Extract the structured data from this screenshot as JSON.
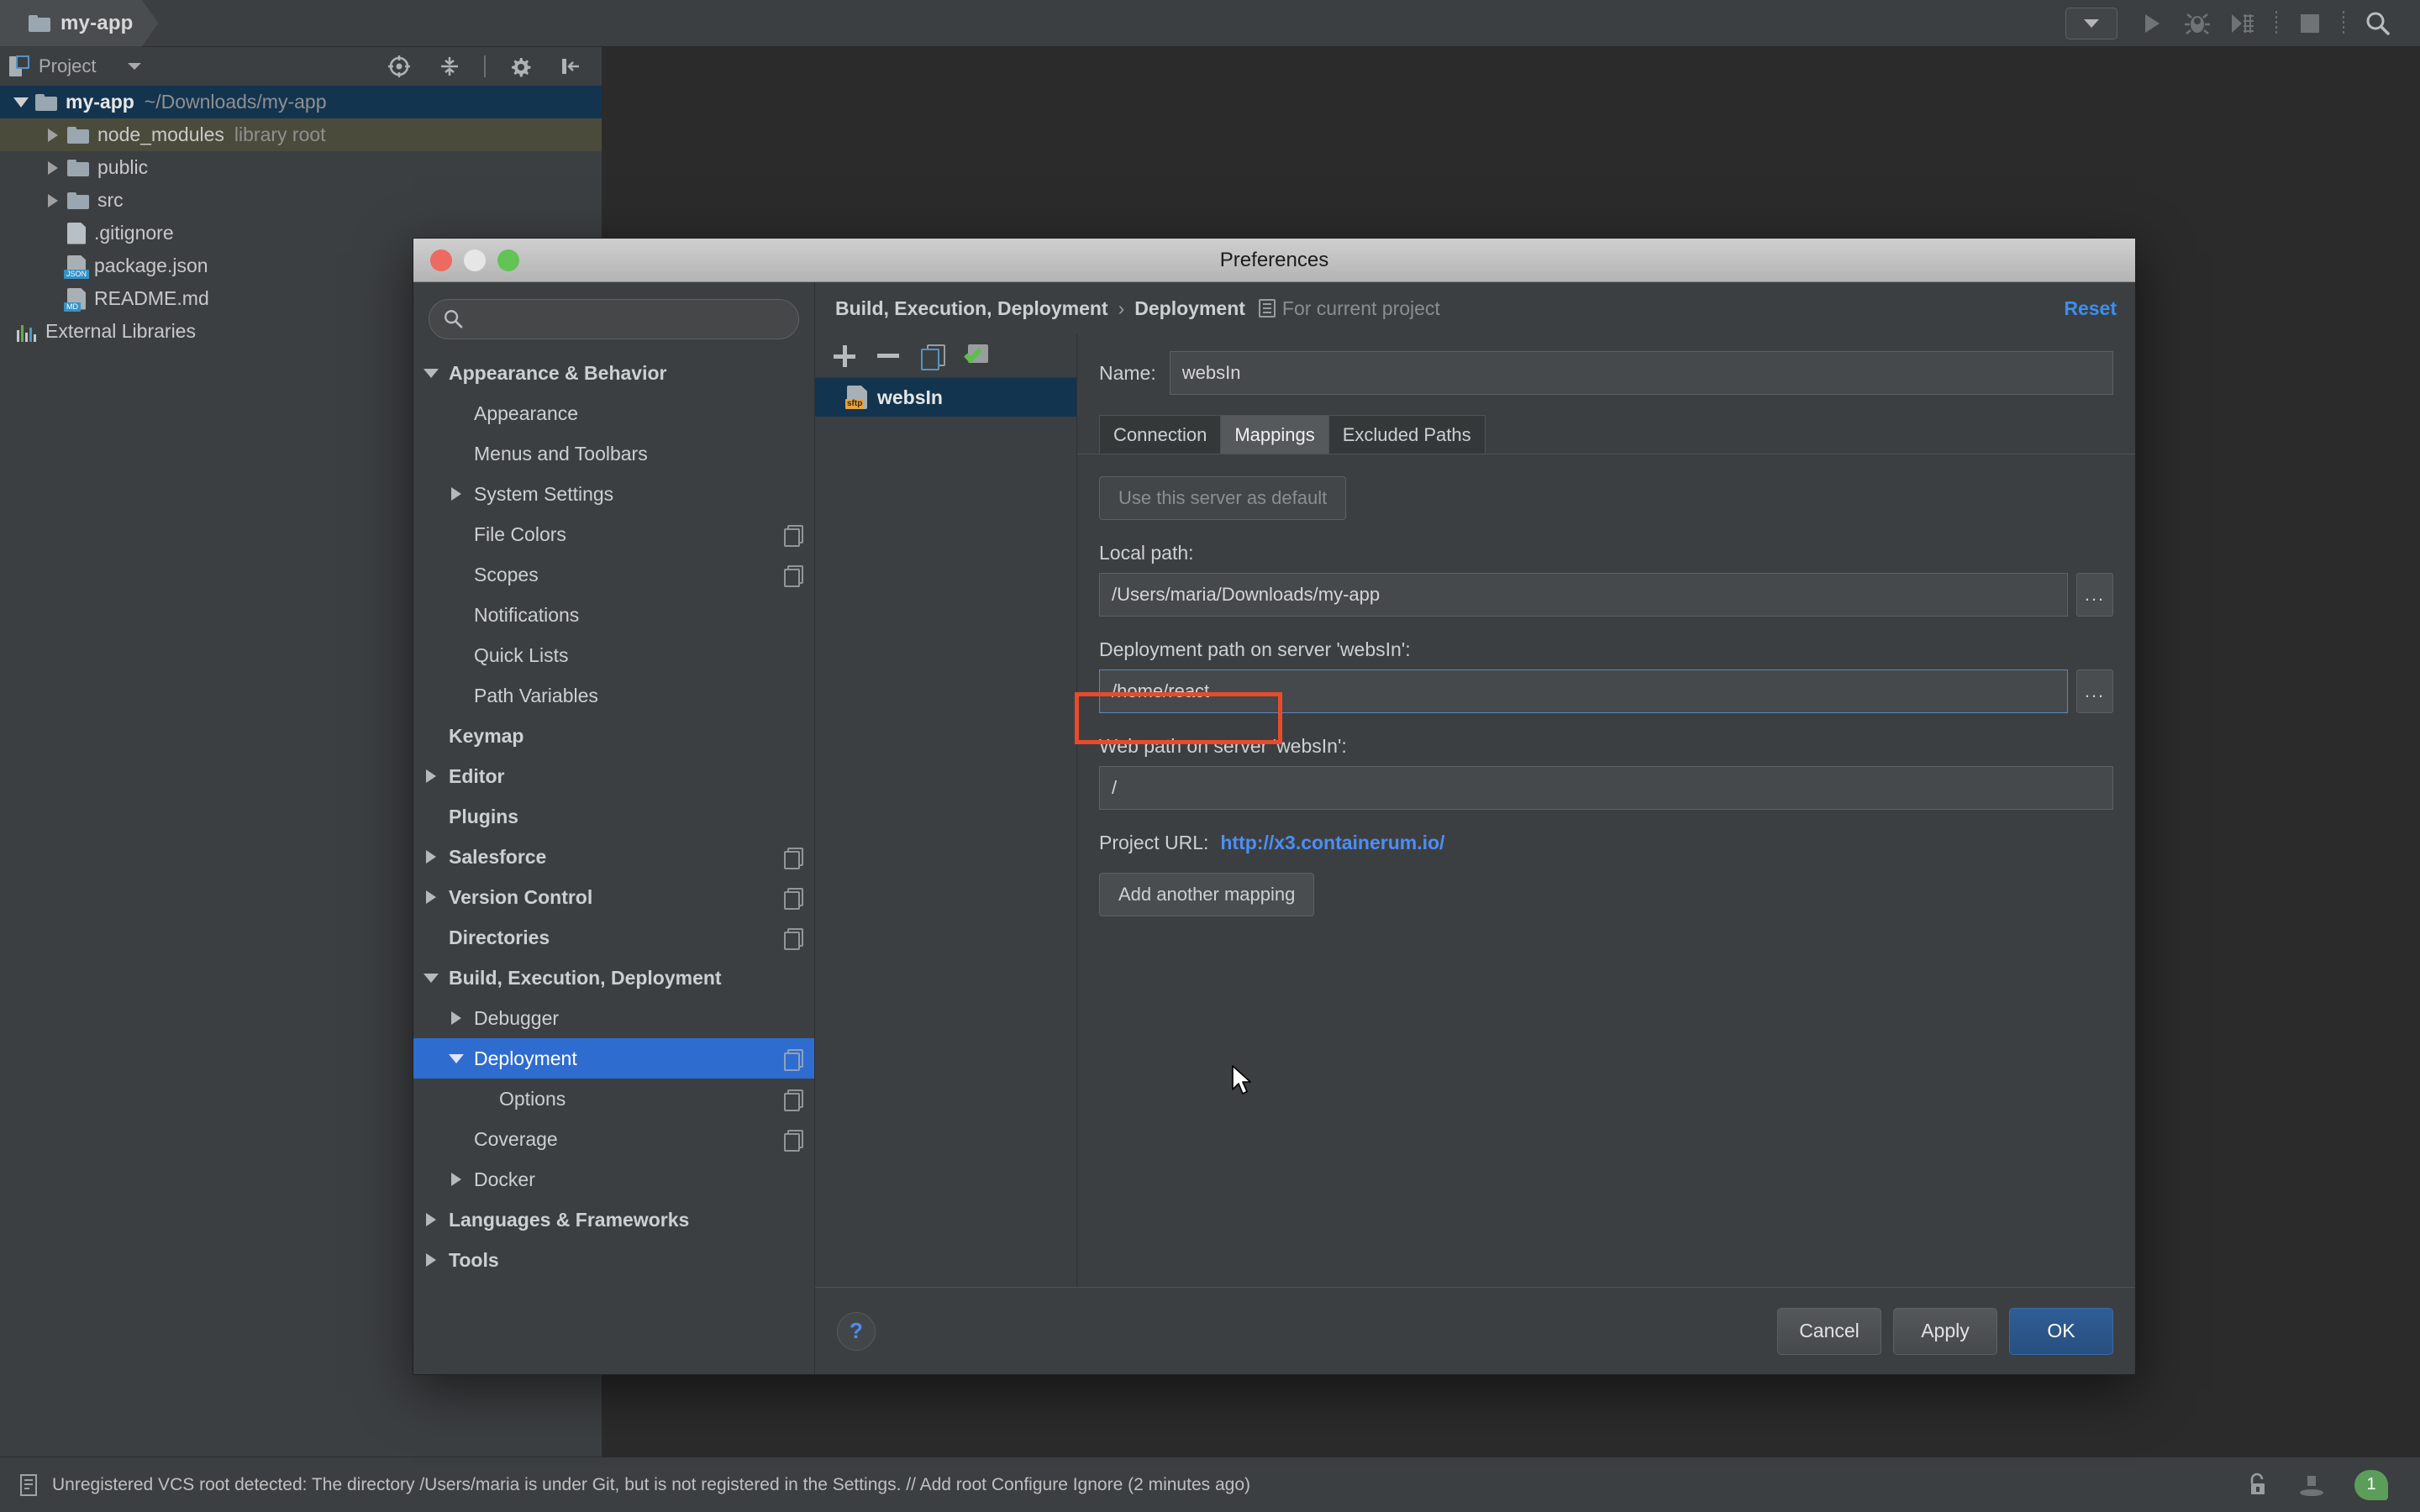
{
  "ide": {
    "breadcrumb": {
      "project": "my-app",
      "folder_icon": "folder-icon"
    },
    "toolbar": {
      "run_config_dropdown": "run-configuration-dropdown",
      "run": "run-icon",
      "debug": "debug-icon",
      "coverage": "run-with-coverage-icon",
      "stop": "stop-icon",
      "search": "search-everywhere-icon"
    }
  },
  "project_tool_window": {
    "title": "Project",
    "icons": {
      "project_view": "project-view-icon",
      "dropdown": "chevron-down-icon",
      "locate": "scroll-from-source-icon",
      "collapse": "collapse-all-icon",
      "settings": "gear-icon",
      "hide": "hide-icon"
    },
    "tree": [
      {
        "label": "my-app",
        "suffix": "~/Downloads/my-app",
        "icon": "folder-icon",
        "twisty": "expanded",
        "indent": 1,
        "state": "selected"
      },
      {
        "label": "node_modules",
        "suffix": "library root",
        "icon": "folder-icon",
        "twisty": "collapsed",
        "indent": 2,
        "state": "library"
      },
      {
        "label": "public",
        "suffix": "",
        "icon": "folder-icon",
        "twisty": "collapsed",
        "indent": 2,
        "state": "normal"
      },
      {
        "label": "src",
        "suffix": "",
        "icon": "folder-icon",
        "twisty": "collapsed",
        "indent": 2,
        "state": "normal"
      },
      {
        "label": ".gitignore",
        "suffix": "",
        "icon": "text-file-icon",
        "twisty": "none",
        "indent": 3,
        "state": "normal",
        "badge": ""
      },
      {
        "label": "package.json",
        "suffix": "",
        "icon": "json-file-icon",
        "twisty": "none",
        "indent": 3,
        "state": "normal",
        "badge": "JSON"
      },
      {
        "label": "README.md",
        "suffix": "",
        "icon": "markdown-file-icon",
        "twisty": "none",
        "indent": 3,
        "state": "normal",
        "badge": "MD"
      },
      {
        "label": "External Libraries",
        "suffix": "",
        "icon": "external-libraries-icon",
        "twisty": "none",
        "indent": 1,
        "state": "normal"
      }
    ]
  },
  "status_bar": {
    "message": "Unregistered VCS root detected: The directory /Users/maria is under Git, but is not registered in the Settings. // Add root  Configure  Ignore (2 minutes ago)",
    "icons": {
      "left": "event-log-icon",
      "lock": "unlocked-icon",
      "hat": "hat-icon"
    },
    "notification_count": "1"
  },
  "dialog": {
    "title": "Preferences",
    "window_controls": {
      "close": "close-button",
      "minimize": "minimize-button",
      "zoom": "zoom-button"
    },
    "search": {
      "value": "",
      "placeholder": "",
      "icon": "search-icon"
    },
    "settings_tree": [
      {
        "label": "Appearance & Behavior",
        "indent": 0,
        "twisty": "expanded",
        "bold": true,
        "copy": false,
        "selected": false
      },
      {
        "label": "Appearance",
        "indent": 1,
        "twisty": "none",
        "bold": false,
        "copy": false,
        "selected": false
      },
      {
        "label": "Menus and Toolbars",
        "indent": 1,
        "twisty": "none",
        "bold": false,
        "copy": false,
        "selected": false
      },
      {
        "label": "System Settings",
        "indent": 1,
        "twisty": "collapsed",
        "bold": false,
        "copy": false,
        "selected": false
      },
      {
        "label": "File Colors",
        "indent": 1,
        "twisty": "none",
        "bold": false,
        "copy": true,
        "selected": false
      },
      {
        "label": "Scopes",
        "indent": 1,
        "twisty": "none",
        "bold": false,
        "copy": true,
        "selected": false
      },
      {
        "label": "Notifications",
        "indent": 1,
        "twisty": "none",
        "bold": false,
        "copy": false,
        "selected": false
      },
      {
        "label": "Quick Lists",
        "indent": 1,
        "twisty": "none",
        "bold": false,
        "copy": false,
        "selected": false
      },
      {
        "label": "Path Variables",
        "indent": 1,
        "twisty": "none",
        "bold": false,
        "copy": false,
        "selected": false
      },
      {
        "label": "Keymap",
        "indent": 0,
        "twisty": "none",
        "bold": true,
        "copy": false,
        "selected": false
      },
      {
        "label": "Editor",
        "indent": 0,
        "twisty": "collapsed",
        "bold": true,
        "copy": false,
        "selected": false
      },
      {
        "label": "Plugins",
        "indent": 0,
        "twisty": "none",
        "bold": true,
        "copy": false,
        "selected": false
      },
      {
        "label": "Salesforce",
        "indent": 0,
        "twisty": "collapsed",
        "bold": true,
        "copy": true,
        "selected": false
      },
      {
        "label": "Version Control",
        "indent": 0,
        "twisty": "collapsed",
        "bold": true,
        "copy": true,
        "selected": false
      },
      {
        "label": "Directories",
        "indent": 0,
        "twisty": "none",
        "bold": true,
        "copy": true,
        "selected": false
      },
      {
        "label": "Build, Execution, Deployment",
        "indent": 0,
        "twisty": "expanded",
        "bold": true,
        "copy": false,
        "selected": false
      },
      {
        "label": "Debugger",
        "indent": 1,
        "twisty": "collapsed",
        "bold": false,
        "copy": false,
        "selected": false
      },
      {
        "label": "Deployment",
        "indent": 1,
        "twisty": "expanded",
        "bold": false,
        "copy": true,
        "selected": true
      },
      {
        "label": "Options",
        "indent": 2,
        "twisty": "none",
        "bold": false,
        "copy": true,
        "selected": false
      },
      {
        "label": "Coverage",
        "indent": 1,
        "twisty": "none",
        "bold": false,
        "copy": true,
        "selected": false
      },
      {
        "label": "Docker",
        "indent": 1,
        "twisty": "collapsed",
        "bold": false,
        "copy": false,
        "selected": false
      },
      {
        "label": "Languages & Frameworks",
        "indent": 0,
        "twisty": "collapsed",
        "bold": true,
        "copy": false,
        "selected": false
      },
      {
        "label": "Tools",
        "indent": 0,
        "twisty": "collapsed",
        "bold": true,
        "copy": false,
        "selected": false
      }
    ],
    "breadcrumbs": {
      "root": "Build, Execution, Deployment",
      "separator": "›",
      "leaf": "Deployment",
      "scope_note": "For current project",
      "reset_label": "Reset"
    },
    "servers": {
      "toolbar": {
        "add": "add-icon",
        "remove": "remove-icon",
        "copy": "copy-icon",
        "default": "set-default-icon"
      },
      "items": [
        {
          "label": "websIn",
          "type": "sftp",
          "selected": true
        }
      ]
    },
    "form": {
      "name_label": "Name:",
      "name_value": "websIn",
      "tabs": [
        {
          "label": "Connection",
          "active": false
        },
        {
          "label": "Mappings",
          "active": true
        },
        {
          "label": "Excluded Paths",
          "active": false
        }
      ],
      "use_default_button": "Use this server as default",
      "local_path_label": "Local path:",
      "local_path_value": "/Users/maria/Downloads/my-app",
      "deployment_path_label": "Deployment path on server 'websIn':",
      "deployment_path_value": "/home/react",
      "web_path_label": "Web path on server 'websIn':",
      "web_path_value": "/",
      "project_url_label": "Project URL:",
      "project_url_value": "http://x3.containerum.io/",
      "add_mapping_button": "Add another mapping",
      "browse_button": "...",
      "highlight_color": "#e84b2c",
      "focus_color": "#5b86c4"
    },
    "footer": {
      "help": "?",
      "cancel": "Cancel",
      "apply": "Apply",
      "ok": "OK"
    }
  }
}
